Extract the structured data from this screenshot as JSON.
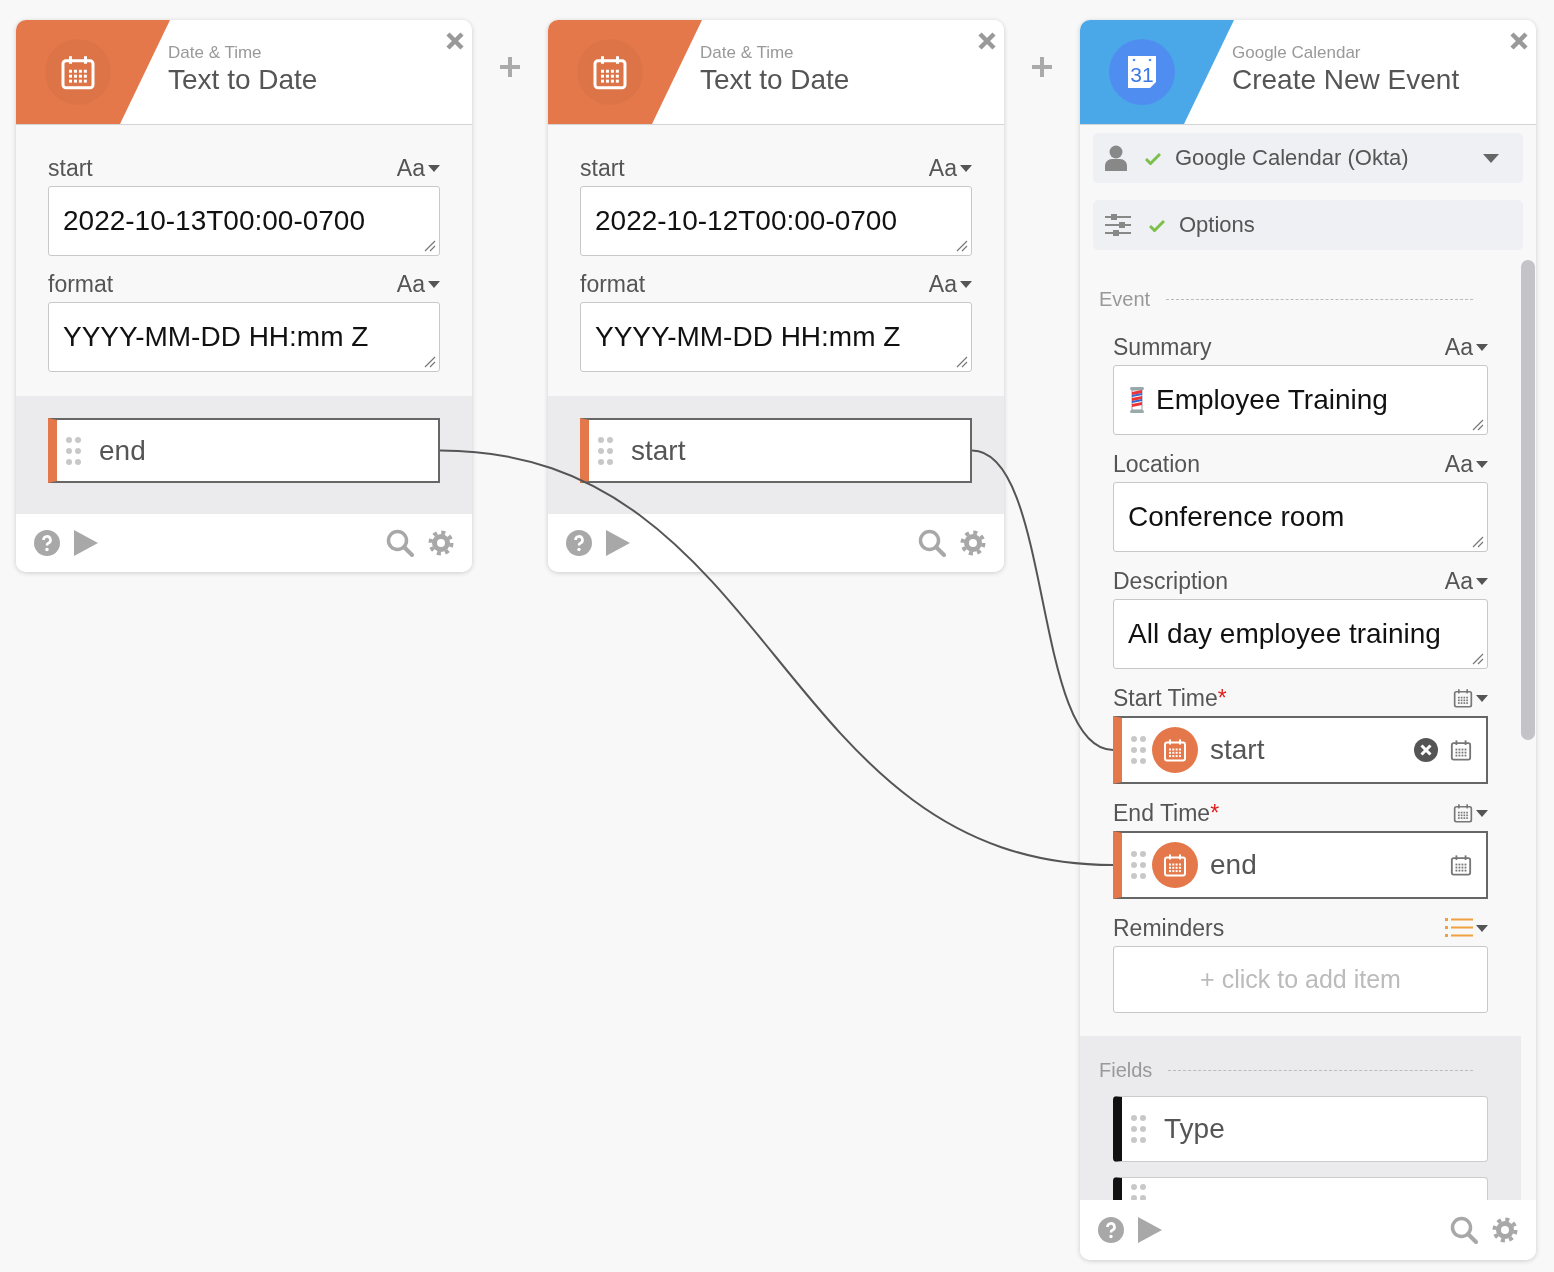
{
  "cards": [
    {
      "kind": "date",
      "category": "Date & Time",
      "title": "Text to Date",
      "inputs": [
        {
          "label": "start",
          "hint": "Aa",
          "value": "2022-10-13T00:00-0700"
        },
        {
          "label": "format",
          "hint": "Aa",
          "value": "YYYY-MM-DD HH:mm Z"
        }
      ],
      "outputs": [
        {
          "label": "end",
          "connected": true
        }
      ]
    },
    {
      "kind": "date",
      "category": "Date & Time",
      "title": "Text to Date",
      "inputs": [
        {
          "label": "start",
          "hint": "Aa",
          "value": "2022-10-12T00:00-0700"
        },
        {
          "label": "format",
          "hint": "Aa",
          "value": "YYYY-MM-DD HH:mm Z"
        }
      ],
      "outputs": [
        {
          "label": "start",
          "connected": true
        }
      ]
    },
    {
      "kind": "calendar",
      "category": "Google Calendar",
      "title": "Create New Event",
      "logo_text": "31",
      "account": {
        "label": "Google Calendar (Okta)",
        "verified": true
      },
      "options": {
        "label": "Options",
        "verified": true
      },
      "sections": [
        {
          "kind": "event",
          "title": "Event",
          "fields": [
            {
              "kind": "text",
              "label": "Summary",
              "hint": "Aa",
              "value": "Employee Training",
              "emoji": true
            },
            {
              "kind": "text",
              "label": "Location",
              "hint": "Aa",
              "value": "Conference room",
              "emoji": false
            },
            {
              "kind": "text",
              "label": "Description",
              "hint": "Aa",
              "value": "All day employee training",
              "emoji": false
            },
            {
              "kind": "mapped",
              "label": "Start Time",
              "required_mark": "*",
              "value": "start",
              "clearable": true
            },
            {
              "kind": "mapped",
              "label": "End Time",
              "required_mark": "*",
              "value": "end",
              "clearable": false
            },
            {
              "kind": "list",
              "label": "Reminders",
              "placeholder": "+ click to add item"
            }
          ]
        },
        {
          "kind": "fields",
          "title": "Fields",
          "fields": [
            {
              "kind": "pill",
              "label": "Type"
            },
            {
              "kind": "clipped"
            }
          ]
        }
      ]
    }
  ]
}
